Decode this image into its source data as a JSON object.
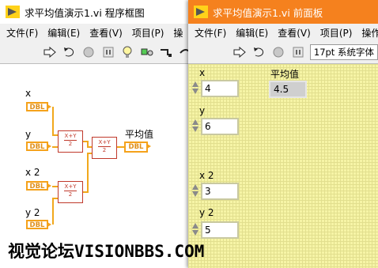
{
  "block_diagram": {
    "title": "求平均值演示1.vi 程序框图",
    "menu": [
      "文件(F)",
      "编辑(E)",
      "查看(V)",
      "项目(P)",
      "操"
    ],
    "inputs": [
      {
        "label": "x",
        "terminal": "DBL"
      },
      {
        "label": "y",
        "terminal": "DBL"
      },
      {
        "label": "x 2",
        "terminal": "DBL"
      },
      {
        "label": "y 2",
        "terminal": "DBL"
      }
    ],
    "formula_num": "X+Y",
    "formula_den": "2",
    "output": {
      "label": "平均值",
      "terminal": "DBL"
    }
  },
  "front_panel": {
    "title": "求平均值演示1.vi 前面板",
    "menu": [
      "文件(F)",
      "编辑(E)",
      "查看(V)",
      "项目(P)",
      "操作"
    ],
    "font_selector": "17pt 系统字体",
    "controls": [
      {
        "label": "x",
        "value": "4"
      },
      {
        "label": "y",
        "value": "6"
      },
      {
        "label": "x 2",
        "value": "3"
      },
      {
        "label": "y 2",
        "value": "5"
      }
    ],
    "indicator": {
      "label": "平均值",
      "value": "4.5"
    }
  },
  "watermark": "视觉论坛VISIONBBS.COM",
  "colors": {
    "block_titlebar": "#ffffff",
    "front_titlebar": "#f5811e",
    "wire": "#f1a81c",
    "node_border": "#c0392b",
    "panel_bg": "#f6f4a6"
  }
}
